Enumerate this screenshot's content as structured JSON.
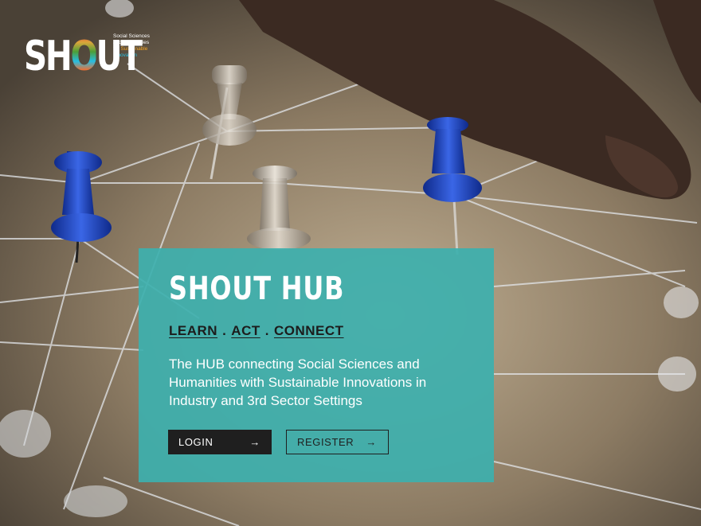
{
  "logo": {
    "wordmark_start": "SH",
    "wordmark_o": "O",
    "wordmark_end": "UT",
    "tagline_line1": "Social Sciences",
    "tagline_line2": "and Humanities",
    "tagline_line3": "for Sustainable",
    "tagline_line4": "Innovation"
  },
  "hero": {
    "title": "SHOUT HUB",
    "tagline": {
      "learn": "LEARN",
      "act": "ACT",
      "connect": "CONNECT",
      "separator": "."
    },
    "description": "The HUB connecting Social Sciences and Humanities with Sustainable Innovations in Industry and 3rd Sector Settings",
    "login_label": "LOGIN",
    "register_label": "REGISTER",
    "arrow_icon": "arrow-right-icon",
    "arrow_glyph": "→"
  },
  "colors": {
    "panel": "#3db0ae",
    "login_button": "#1f1f1f",
    "pin_blue": "#1d3fb0"
  }
}
